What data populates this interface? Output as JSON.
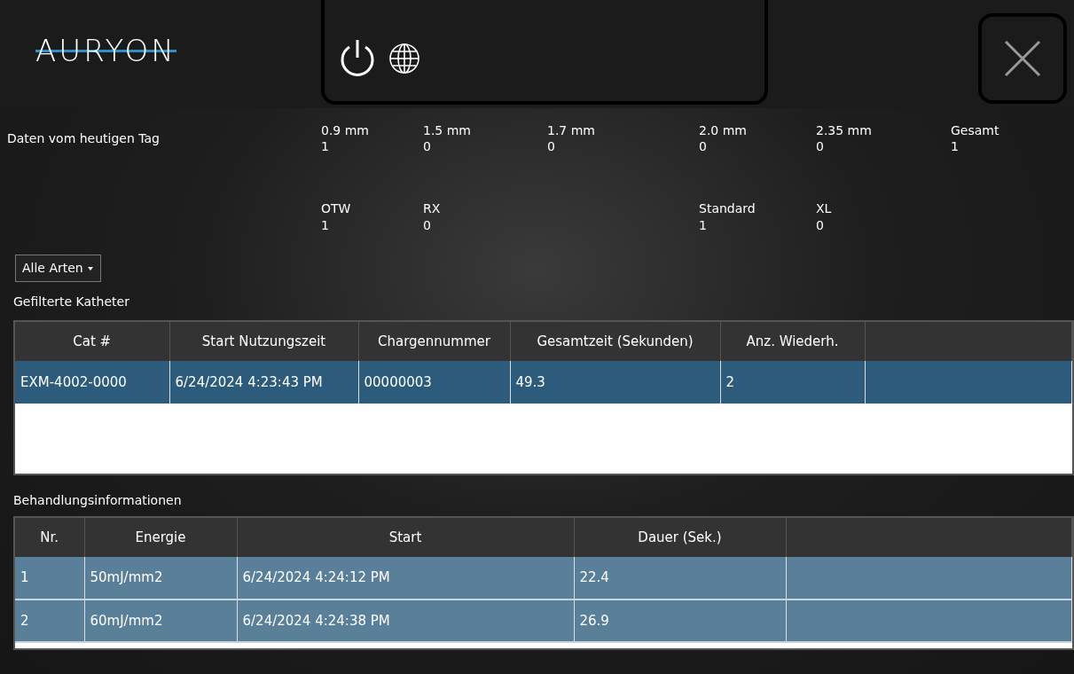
{
  "header": {
    "logo": "AURYON"
  },
  "summary": {
    "label": "Daten vom heutigen Tag",
    "sizes": [
      {
        "name": "0.9 mm",
        "count": "1"
      },
      {
        "name": "1.5 mm",
        "count": "0"
      },
      {
        "name": "1.7 mm",
        "count": "0"
      },
      {
        "name": "2.0 mm",
        "count": "0"
      },
      {
        "name": "2.35 mm",
        "count": "0"
      },
      {
        "name": "Gesamt",
        "count": "1"
      }
    ],
    "types": [
      {
        "name": "OTW",
        "count": "1"
      },
      {
        "name": "RX",
        "count": "0"
      },
      {
        "name": "Standard",
        "count": "1"
      },
      {
        "name": "XL",
        "count": "0"
      }
    ]
  },
  "filter": {
    "value": "Alle Arten"
  },
  "catheters": {
    "title": "Gefilterte Katheter",
    "columns": [
      "Cat #",
      "Start Nutzungszeit",
      "Chargennummer",
      "Gesamtzeit (Sekunden)",
      "Anz. Wiederh."
    ],
    "rows": [
      {
        "cells": [
          "EXM-4002-0000",
          "6/24/2024 4:23:43 PM",
          "00000003",
          "49.3",
          "2"
        ],
        "selected": true
      }
    ]
  },
  "treatments": {
    "title": "Behandlungsinformationen",
    "columns": [
      "Nr.",
      "Energie",
      "Start",
      "Dauer (Sek.)"
    ],
    "rows": [
      {
        "cells": [
          "1",
          "50mJ/mm2",
          "6/24/2024 4:24:12 PM",
          "22.4"
        ],
        "selected": false
      },
      {
        "cells": [
          "2",
          "60mJ/mm2",
          "6/24/2024 4:24:38 PM",
          "26.9"
        ],
        "selected": false
      }
    ]
  }
}
